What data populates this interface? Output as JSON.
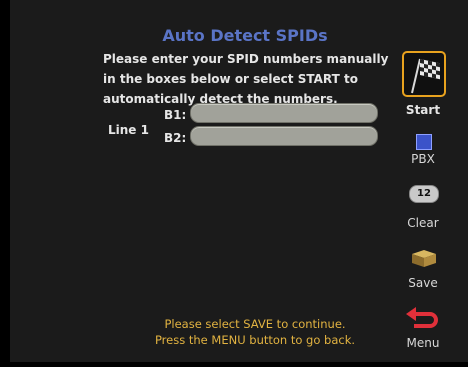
{
  "header": {
    "title": "Auto Detect SPIDs"
  },
  "instructions": [
    "Please enter your SPID numbers manually",
    "in the boxes below or select START to",
    "automatically detect the numbers."
  ],
  "form": {
    "line_label": "Line 1",
    "b1_label": "B1:",
    "b2_label": "B2:",
    "b1_value": "",
    "b2_value": ""
  },
  "footer": {
    "line1": "Please select SAVE to continue.",
    "line2": "Press the MENU button to go back."
  },
  "menu": {
    "start": "Start",
    "pbx": "PBX",
    "clear_icon_text": "12",
    "clear": "Clear",
    "save": "Save",
    "menu": "Menu"
  },
  "colors": {
    "title": "#5a74c6",
    "footer_text": "#e2b341",
    "selection_border": "#e8a21e",
    "field_fill": "#a1a29a"
  },
  "icons": {
    "start": "checkered-flag-icon",
    "pbx": "blue-square-icon",
    "clear": "counter-icon",
    "save": "box-icon",
    "menu": "back-arrow-icon"
  }
}
